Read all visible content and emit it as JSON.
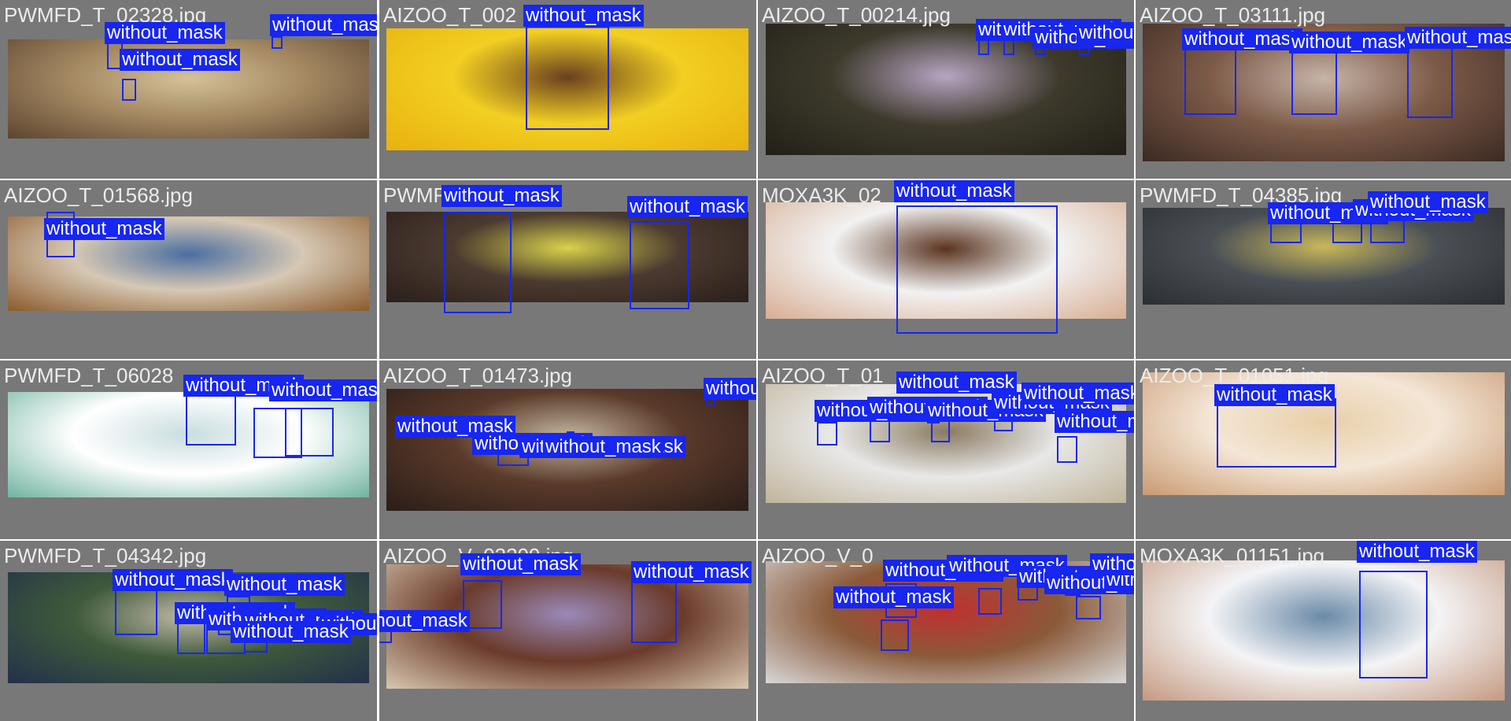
{
  "label_color": "#1726f0",
  "tiles": [
    {
      "filename": "PWMFD_T_02328.jpg",
      "label": "without_mask",
      "photo_colors": [
        "#a58a63",
        "#5c4530",
        "#d4c29a"
      ]
    },
    {
      "filename": "AIZOO_T_002",
      "label": "without_mask",
      "photo_colors": [
        "#f2cf22",
        "#e8b10e",
        "#6a4020"
      ]
    },
    {
      "filename": "AIZOO_T_00214.jpg",
      "label": "without_mask",
      "photo_colors": [
        "#3d3a2c",
        "#221f18",
        "#b7a5c2"
      ]
    },
    {
      "filename": "AIZOO_T_03111.jpg",
      "label": "without_mask",
      "photo_colors": [
        "#7c5a48",
        "#3b2a22",
        "#c6b4a8"
      ]
    },
    {
      "filename": "AIZOO_T_01568.jpg",
      "label": "without_mask",
      "photo_colors": [
        "#d6c8b4",
        "#8b5a2b",
        "#4a6ea0"
      ]
    },
    {
      "filename": "PWMF",
      "label": "without_mask",
      "photo_colors": [
        "#4b3a30",
        "#2a1f1a",
        "#d8d24a"
      ]
    },
    {
      "filename": "MOXA3K_02",
      "label": "without_mask",
      "photo_colors": [
        "#f2f2f2",
        "#d8ad92",
        "#5a3420"
      ]
    },
    {
      "filename": "PWMFD_T_04385.jpg",
      "label": "without_mask",
      "photo_colors": [
        "#4a4f55",
        "#2b2e32",
        "#c9b85a"
      ]
    },
    {
      "filename": "PWMFD_T_06028",
      "label": "without_mask",
      "photo_colors": [
        "#ffffff",
        "#6fb3a0",
        "#c9dde0"
      ]
    },
    {
      "filename": "AIZOO_T_01473.jpg",
      "label": "without_mask",
      "photo_colors": [
        "#5a3a2a",
        "#2a1d18",
        "#c6b8a0"
      ]
    },
    {
      "filename": "AIZOO_T_01",
      "label": "without_mask",
      "photo_colors": [
        "#e8e8e8",
        "#c0b49a",
        "#8a7a60"
      ]
    },
    {
      "filename": "AIZOO_T_01051.jpg",
      "label": "without_mask",
      "photo_colors": [
        "#f4e6d6",
        "#c99a72",
        "#e8cfa8"
      ]
    },
    {
      "filename": "PWMFD_T_04342.jpg",
      "label": "without_mask",
      "photo_colors": [
        "#3e5a3a",
        "#22304a",
        "#c0b8a8"
      ]
    },
    {
      "filename": "AIZOO_V_03209.jpg",
      "label": "without_mask",
      "photo_colors": [
        "#6a3a2a",
        "#d8c8b0",
        "#9a8ab8"
      ]
    },
    {
      "filename": "AIZOO_V_0",
      "label": "without_mask",
      "photo_colors": [
        "#8a5a3a",
        "#d8d8d8",
        "#c03030"
      ]
    },
    {
      "filename": "MOXA3K_01151.jpg",
      "label": "without_mask",
      "photo_colors": [
        "#f4f4f6",
        "#c59a80",
        "#6a8aa8"
      ]
    }
  ]
}
